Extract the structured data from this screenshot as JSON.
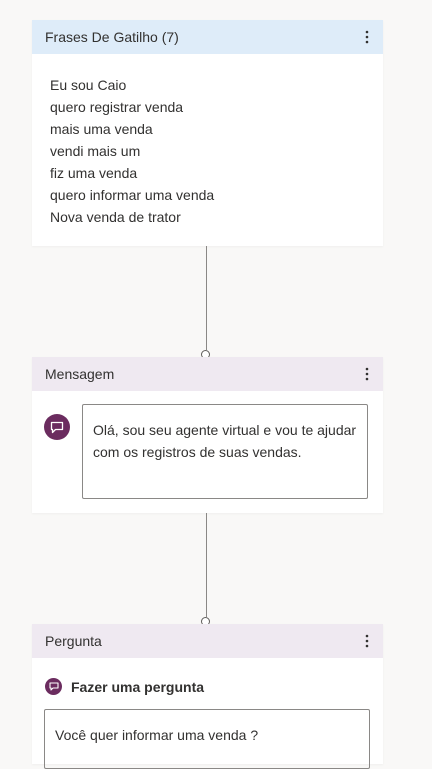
{
  "trigger_card": {
    "title": "Frases De Gatilho (7)",
    "phrases": [
      "Eu sou Caio",
      "quero registrar venda",
      "mais uma venda",
      "vendi mais um",
      "fiz uma venda",
      "quero informar uma venda",
      "Nova venda de trator"
    ]
  },
  "message_card": {
    "title": "Mensagem",
    "text": "Olá, sou seu agente virtual e vou te ajudar com os registros de suas vendas."
  },
  "question_card": {
    "title": "Pergunta",
    "ask_label": "Fazer uma pergunta",
    "question_text": "Você quer informar uma venda ?"
  },
  "icons": {
    "more": "more-vertical-icon",
    "message": "chat-bubble-icon",
    "question": "question-bubble-icon"
  },
  "colors": {
    "trigger_header": "#deecf9",
    "node_header": "#efe9f1",
    "icon_accent": "#6b2c5f",
    "canvas": "#f9f8f7"
  }
}
